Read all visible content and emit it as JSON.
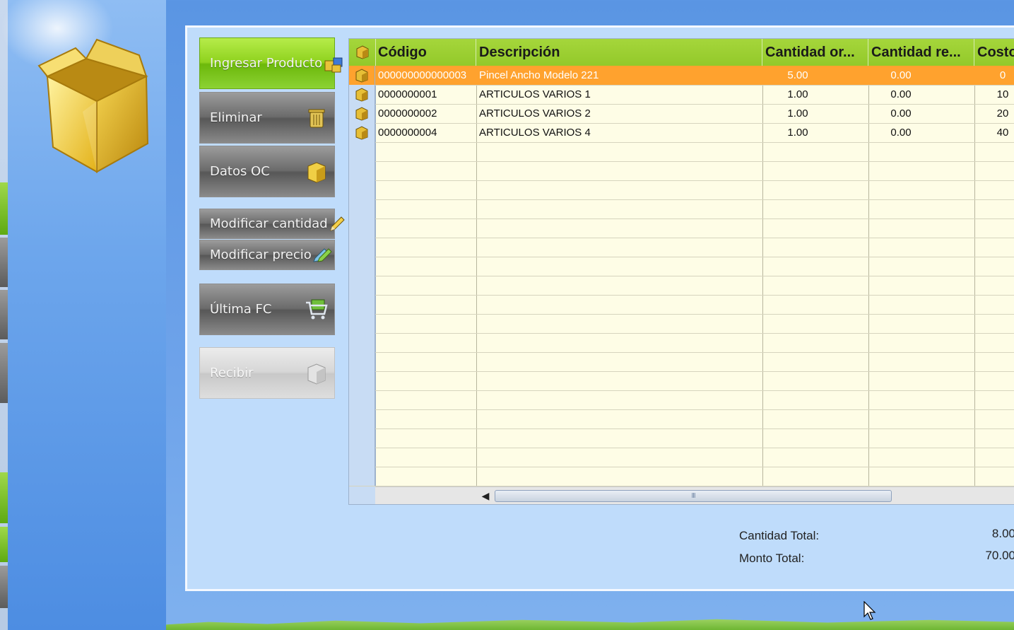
{
  "buttons": {
    "ingresar_producto": "Ingresar Producto",
    "eliminar": "Eliminar",
    "datos_oc": "Datos OC",
    "modificar_cantidad": "Modificar cantidad",
    "modificar_precio": "Modificar precio",
    "ultima_fc": "Última FC",
    "recibir": "Recibir"
  },
  "grid": {
    "columns": [
      "Código",
      "Descripción",
      "Cantidad or...",
      "Cantidad re...",
      "Costo"
    ],
    "rows": [
      {
        "codigo": "000000000000003",
        "descripcion": "Pincel Ancho Modelo 221",
        "cant_or": "5.00",
        "cant_re": "0.00",
        "costo": "0",
        "selected": true
      },
      {
        "codigo": "0000000001",
        "descripcion": "ARTICULOS VARIOS 1",
        "cant_or": "1.00",
        "cant_re": "0.00",
        "costo": "10",
        "selected": false
      },
      {
        "codigo": "0000000002",
        "descripcion": "ARTICULOS VARIOS 2",
        "cant_or": "1.00",
        "cant_re": "0.00",
        "costo": "20",
        "selected": false
      },
      {
        "codigo": "0000000004",
        "descripcion": "ARTICULOS VARIOS 4",
        "cant_or": "1.00",
        "cant_re": "0.00",
        "costo": "40",
        "selected": false
      }
    ],
    "scrollbar_grip": "III"
  },
  "totals": {
    "cantidad_label": "Cantidad Total:",
    "cantidad_value": "8.00",
    "monto_label": "Monto Total:",
    "monto_value": "70.00"
  },
  "colors": {
    "header_green": "#9ccf33",
    "selected_row": "#ffa22e",
    "grid_bg": "#fefde6",
    "card_bg": "#bfdcfb"
  }
}
